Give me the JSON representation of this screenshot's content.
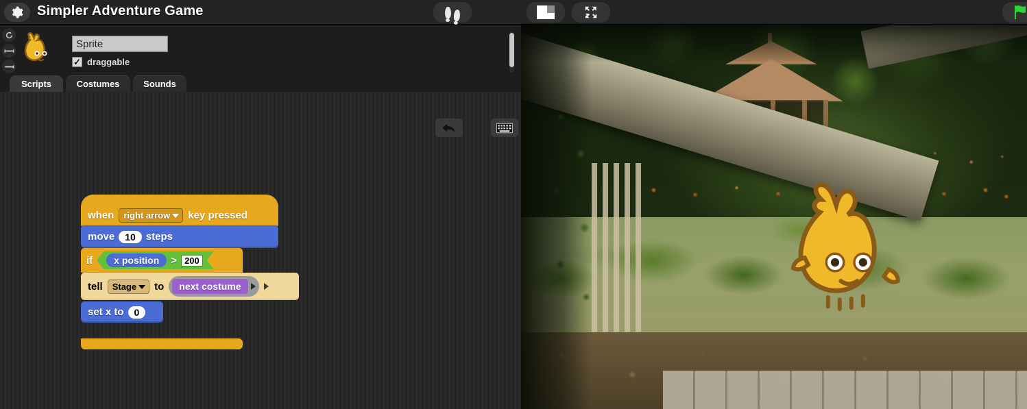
{
  "topbar": {
    "title": "Simpler Adventure Game",
    "gear_icon": "gear-icon",
    "buttons": [
      {
        "name": "presentation-footprints-button",
        "icon": "footprints-icon"
      },
      {
        "name": "small-stage-button",
        "icon": "small-stage-layout-icon"
      },
      {
        "name": "full-stage-button",
        "icon": "fullscreen-arrows-icon"
      },
      {
        "name": "green-flag-button",
        "icon": "green-flag-icon"
      }
    ],
    "accent_green": "#2bd833",
    "background": "#232323"
  },
  "sprite_info": {
    "rotation_styles": [
      {
        "name": "rotate-all-around",
        "glyph": "↺"
      },
      {
        "name": "rotate-left-right",
        "glyph": "↔"
      },
      {
        "name": "rotate-do-not-rotate",
        "glyph": "→"
      }
    ],
    "thumbnail_name": "sprite-thumbnail",
    "name_value": "Sprite",
    "name_placeholder": "Sprite",
    "draggable_label": "draggable",
    "draggable_checked": true,
    "checkbox_glyph": "✓"
  },
  "tabs": [
    {
      "label": "Scripts",
      "selected": true
    },
    {
      "label": "Costumes",
      "selected": false
    },
    {
      "label": "Sounds",
      "selected": false
    }
  ],
  "script_area": {
    "undo_icon": "undo-arrow-icon",
    "keyboard_icon": "keyboard-icon"
  },
  "script": {
    "hat": {
      "prefix": "when",
      "dropdown_value": "right arrow",
      "suffix": "key pressed",
      "color": "#e8a81d"
    },
    "move": {
      "prefix": "move",
      "value": "10",
      "suffix": "steps",
      "color": "#4a6cd4"
    },
    "if": {
      "keyword": "if",
      "operand_left": "x position",
      "operator": ">",
      "operand_right": "200",
      "control_color": "#e8a81d",
      "operator_color": "#62c03b",
      "reporter_color": "#4a6cd4"
    },
    "tell": {
      "prefix": "tell",
      "dropdown_value": "Stage",
      "middle": "to",
      "ring_block": "next costume",
      "block_color": "#f0d79a",
      "ring_block_color": "#9b5fd0"
    },
    "set_x": {
      "prefix": "set x to",
      "value": "0",
      "color": "#4a6cd4"
    }
  },
  "stage": {
    "backdrop_name": "garden-backdrop",
    "sprite_name": "gobo-sprite"
  }
}
